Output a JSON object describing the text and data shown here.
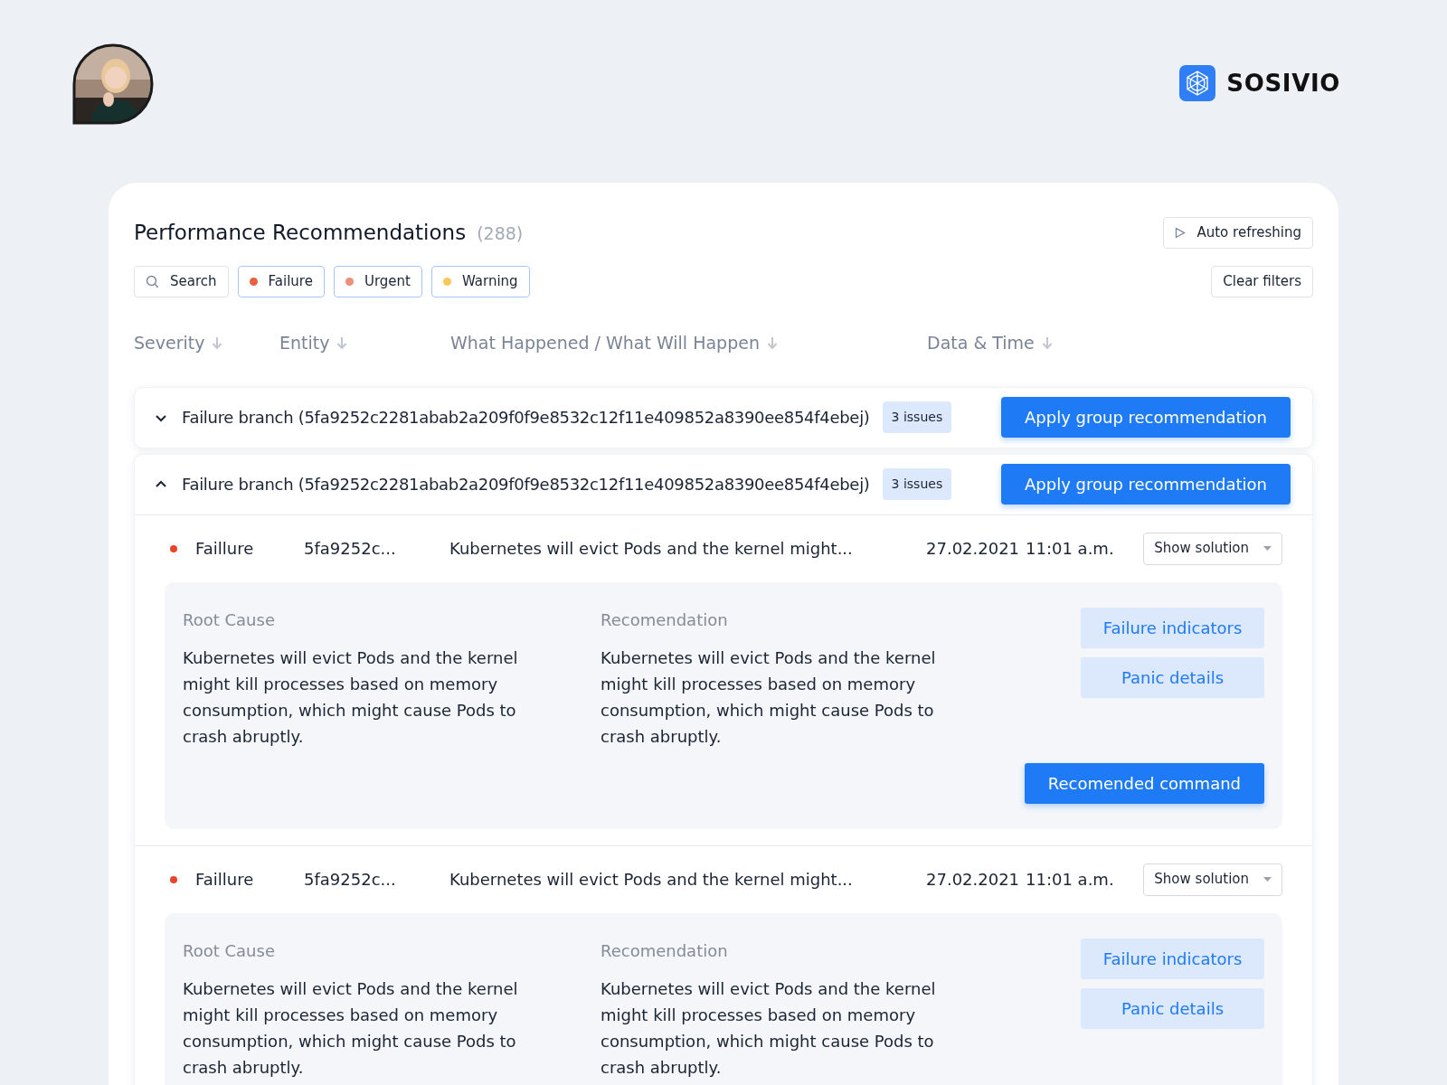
{
  "brand": {
    "name": "SOSIVIO"
  },
  "panel": {
    "title": "Performance Recommendations",
    "count": "(288)",
    "auto_refresh": "Auto refreshing",
    "clear_filters": "Clear filters"
  },
  "filters": [
    {
      "kind": "search",
      "label": "Search"
    },
    {
      "kind": "tag",
      "label": "Failure",
      "color": "#e8603f"
    },
    {
      "kind": "tag",
      "label": "Urgent",
      "color": "#ef8f78"
    },
    {
      "kind": "tag",
      "label": "Warning",
      "color": "#f8c85a"
    }
  ],
  "columns": [
    "Severity",
    "Entity",
    "What Happened / What Will Happen",
    "Data & Time"
  ],
  "groups": [
    {
      "title": "Failure branch (5fa9252c2281abab2a209f0f9e8532c12f11e409852a8390ee854f4ebej)",
      "badge": "3 issues",
      "action": "Apply group recommendation",
      "expanded": false
    },
    {
      "title": "Failure branch (5fa9252c2281abab2a209f0f9e8532c12f11e409852a8390ee854f4ebej)",
      "badge": "3 issues",
      "action": "Apply group recommendation",
      "expanded": true,
      "items": [
        {
          "severity": "Faillure",
          "color": "#e8452c",
          "entity": "5fa9252c...",
          "what": "Kubernetes will evict Pods and the kernel might...",
          "date": "27.02.2021",
          "time": "11:01 a.m.",
          "dropdown": "Show solution",
          "root_label": "Root Cause",
          "root_text": "Kubernetes will evict Pods and the kernel might kill processes based on memory consumption, which might cause Pods to crash abruptly.",
          "rec_label": "Recomendation",
          "rec_text": "Kubernetes will evict Pods and the kernel might kill processes based on memory consumption, which might cause Pods to crash abruptly.",
          "buttons": [
            "Failure indicators",
            "Panic details"
          ],
          "command": "Recomended command"
        },
        {
          "severity": "Faillure",
          "color": "#e8452c",
          "entity": "5fa9252c...",
          "what": "Kubernetes will evict Pods and the kernel might...",
          "date": "27.02.2021",
          "time": "11:01 a.m.",
          "dropdown": "Show solution",
          "root_label": "Root Cause",
          "root_text": "Kubernetes will evict Pods and the kernel might kill processes based on memory consumption, which might cause Pods to crash abruptly.",
          "rec_label": "Recomendation",
          "rec_text": "Kubernetes will evict Pods and the kernel might kill processes based on memory consumption, which might cause Pods to crash abruptly.",
          "buttons": [
            "Failure indicators",
            "Panic details"
          ]
        }
      ]
    }
  ]
}
